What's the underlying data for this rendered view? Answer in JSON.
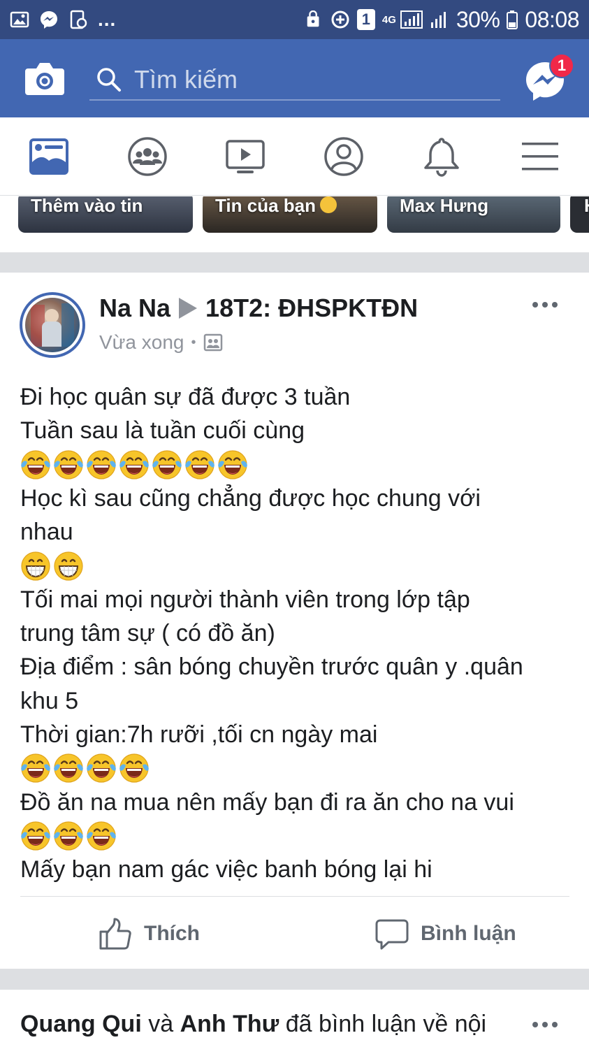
{
  "status_bar": {
    "network": "4G",
    "battery": "30%",
    "time": "08:08",
    "sim_label": "1",
    "more": "..."
  },
  "header": {
    "search_placeholder": "Tìm kiếm",
    "messenger_badge": "1",
    "brand_color": "#4267b2"
  },
  "tabs": [
    {
      "icon": "news-feed-icon",
      "active": true
    },
    {
      "icon": "groups-icon"
    },
    {
      "icon": "watch-icon"
    },
    {
      "icon": "profile-icon"
    },
    {
      "icon": "notifications-icon"
    },
    {
      "icon": "menu-icon"
    }
  ],
  "stories": [
    {
      "label": "Thêm vào tin"
    },
    {
      "label": "Tin của bạn"
    },
    {
      "label": "Max Hưng"
    }
  ],
  "post": {
    "author": "Na Na",
    "group": "18T2: ĐHSPKTĐN",
    "time": "Vừa xong",
    "audience_icon": "group-audience-icon",
    "lines": [
      "Đi học quân sự đã được 3 tuần",
      "Tuần sau là tuần cuối cùng",
      "Học kì sau cũng chẳng được học chung với",
      "nhau",
      "Tối mai mọi người thành viên trong lớp tập",
      "trung tâm sự ( có đồ ăn)",
      "Địa điểm : sân bóng chuyền trước quân y .quân",
      "khu 5",
      "Thời gian:7h rưỡi ,tối cn ngày mai",
      "Đồ ăn na mua nên mấy bạn đi ra ăn cho na  vui",
      "Mấy bạn nam gác việc banh bóng lại hi"
    ],
    "emoji_rows": {
      "row1": {
        "type": "tears-of-joy",
        "count": 7
      },
      "row2": {
        "type": "grinning",
        "count": 2
      },
      "row3": {
        "type": "tears-of-joy",
        "count": 4
      },
      "row4": {
        "type": "tears-of-joy",
        "count": 3
      }
    },
    "like_label": "Thích",
    "comment_label": "Bình luận"
  },
  "next_post": {
    "name1": "Quang Qui",
    "connector": " và ",
    "name2": "Anh Thư",
    "rest": " đã bình luận về nội"
  }
}
